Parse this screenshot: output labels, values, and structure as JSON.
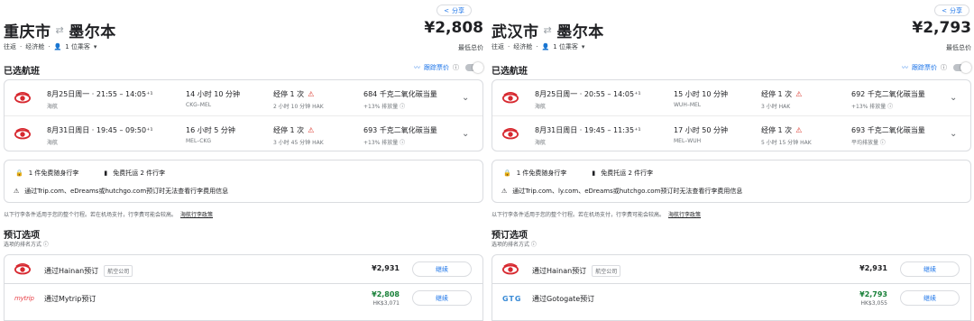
{
  "left": {
    "share": "分享",
    "origin": "重庆市",
    "destination": "墨尔本",
    "price": "¥2,808",
    "trip_type": "往返",
    "cabin": "经济舱",
    "passengers": "1 位乘客",
    "lowest_label": "最低总价",
    "selected_title": "已选航班",
    "track_label": "跟踪票价",
    "flights": [
      {
        "time": "8月25日周一 · 21:55 – 14:05⁺¹",
        "airline": "海航",
        "duration": "14 小时 10 分钟",
        "route": "CKG–MEL",
        "stops": "经停 1 次",
        "stop_detail": "2 小时 10 分钟 HAK",
        "co2": "684 千克二氧化碳当量",
        "co2_sub": "+13% 排放量 ⓘ"
      },
      {
        "time": "8月31日周日 · 19:45 – 09:50⁺¹",
        "airline": "海航",
        "duration": "16 小时 5 分钟",
        "route": "MEL–CKG",
        "stops": "经停 1 次",
        "stop_detail": "3 小时 45 分钟 HAK",
        "co2": "693 千克二氧化碳当量",
        "co2_sub": "+13% 排放量 ⓘ"
      }
    ],
    "carry_on": "1 件免费随身行李",
    "checked": "免费托运 2 件行李",
    "bag_warning": "通过Trip.com、eDreams或hutchgo.com预订时无法查看行李费用信息",
    "note": "以下行李条件适用于您的整个行程。若在机场支付，行李费可能会较高。",
    "note_link": "海航行李政策",
    "booking_title": "预订选项",
    "booking_sub": "选项的排名方式 ⓘ",
    "options": [
      {
        "via": "通过Hainan预订",
        "tag": "航空公司",
        "price": "¥2,931",
        "hk": "",
        "button": "继续"
      },
      {
        "via": "通过Mytrip预订",
        "logo_text": "mytrip",
        "tag": "",
        "price": "¥2,808",
        "hk": "HK$3,071",
        "button": "继续"
      }
    ]
  },
  "right": {
    "share": "分享",
    "origin": "武汉市",
    "destination": "墨尔本",
    "price": "¥2,793",
    "trip_type": "往返",
    "cabin": "经济舱",
    "passengers": "1 位乘客",
    "lowest_label": "最低总价",
    "selected_title": "已选航班",
    "track_label": "跟踪票价",
    "flights": [
      {
        "time": "8月25日周一 · 20:55 – 14:05⁺¹",
        "airline": "海航",
        "duration": "15 小时 10 分钟",
        "route": "WUH–MEL",
        "stops": "经停 1 次",
        "stop_detail": "3 小时 HAK",
        "co2": "692 千克二氧化碳当量",
        "co2_sub": "+13% 排放量 ⓘ"
      },
      {
        "time": "8月31日周日 · 19:45 – 11:35⁺¹",
        "airline": "海航",
        "duration": "17 小时 50 分钟",
        "route": "MEL–WUH",
        "stops": "经停 1 次",
        "stop_detail": "5 小时 15 分钟 HAK",
        "co2": "693 千克二氧化碳当量",
        "co2_sub": "平均排放量 ⓘ"
      }
    ],
    "carry_on": "1 件免费随身行李",
    "checked": "免费托运 2 件行李",
    "bag_warning": "通过Trip.com、ly.com、eDreams或hutchgo.com预订时无法查看行李费用信息",
    "note": "以下行李条件适用于您的整个行程。若在机场支付，行李费可能会较高。",
    "note_link": "海航行李政策",
    "booking_title": "预订选项",
    "booking_sub": "选项的排名方式 ⓘ",
    "options": [
      {
        "via": "通过Hainan预订",
        "tag": "航空公司",
        "price": "¥2,931",
        "hk": "",
        "button": "继续"
      },
      {
        "via": "通过Gotogate预订",
        "logo_text": "GTG",
        "tag": "",
        "price": "¥2,793",
        "hk": "HK$3,055",
        "button": "继续"
      }
    ]
  },
  "colors": {
    "accent": "#1a73e8",
    "green_price": "#188038",
    "warning": "#d93025",
    "hainan_red": "#d7282f"
  }
}
